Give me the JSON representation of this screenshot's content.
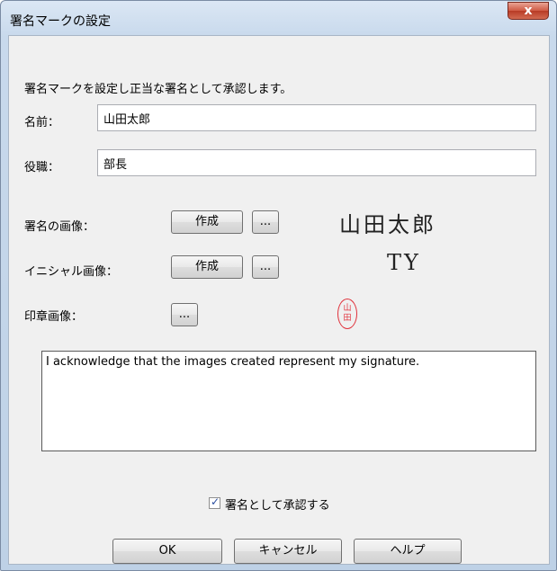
{
  "window": {
    "title": "署名マークの設定",
    "close_label": "x"
  },
  "description": "署名マークを設定し正当な署名として承認します。",
  "name": {
    "label": "名前：",
    "value": "山田太郎"
  },
  "position": {
    "label": "役職：",
    "value": "部長"
  },
  "signature_image": {
    "label": "署名の画像：",
    "create_label": "作成",
    "browse_label": "...",
    "preview": "山田太郎"
  },
  "initial_image": {
    "label": "イニシャル画像：",
    "create_label": "作成",
    "browse_label": "...",
    "preview": "TY"
  },
  "stamp_image": {
    "label": "印章画像：",
    "browse_label": "...",
    "seal_text": "山田"
  },
  "acknowledgement": "I acknowledge that the images created represent my signature.",
  "approve_checkbox": {
    "label": "署名として承認する",
    "checked": true
  },
  "buttons": {
    "ok": "OK",
    "cancel": "キャンセル",
    "help": "ヘルプ"
  }
}
